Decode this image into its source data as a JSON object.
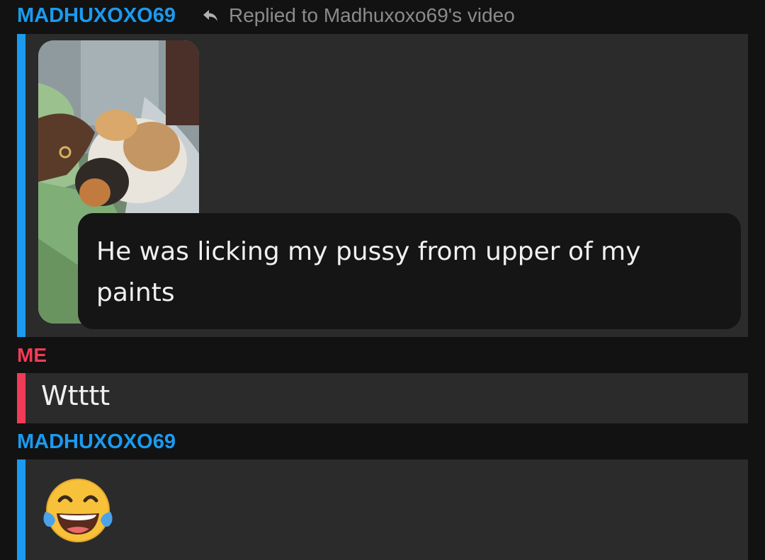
{
  "messages": [
    {
      "sender": "MADHUXOXO69",
      "reply_to": "Replied to Madhuxoxo69's video",
      "reply_icon": "reply-arrow-icon",
      "media": "video-thumbnail",
      "caption": "He was licking my pussy from upper of my paints"
    },
    {
      "sender": "ME",
      "text": "Wtttt"
    },
    {
      "sender": "MADHUXOXO69",
      "emoji": "face-with-tears-of-joy-icon"
    }
  ],
  "colors": {
    "friend": "#1a9bf0",
    "me": "#f23c57",
    "background": "#121212",
    "bubble": "#2b2b2b"
  }
}
